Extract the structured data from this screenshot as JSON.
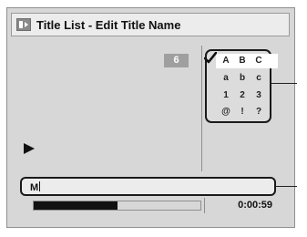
{
  "title_bar": {
    "icon": "title-list-icon",
    "title": "Title List - Edit Title Name"
  },
  "preview": {
    "title_number": "6",
    "play_icon": "play-icon"
  },
  "character_palette": {
    "selected_row": 0,
    "rows": [
      [
        "A",
        "B",
        "C"
      ],
      [
        "a",
        "b",
        "c"
      ],
      [
        "1",
        "2",
        "3"
      ],
      [
        "@",
        "!",
        "?"
      ]
    ],
    "cursor_icon": "checkmark-icon"
  },
  "name_input": {
    "value": "M"
  },
  "playback": {
    "progress_fraction": 0.5,
    "time": "0:00:59"
  }
}
